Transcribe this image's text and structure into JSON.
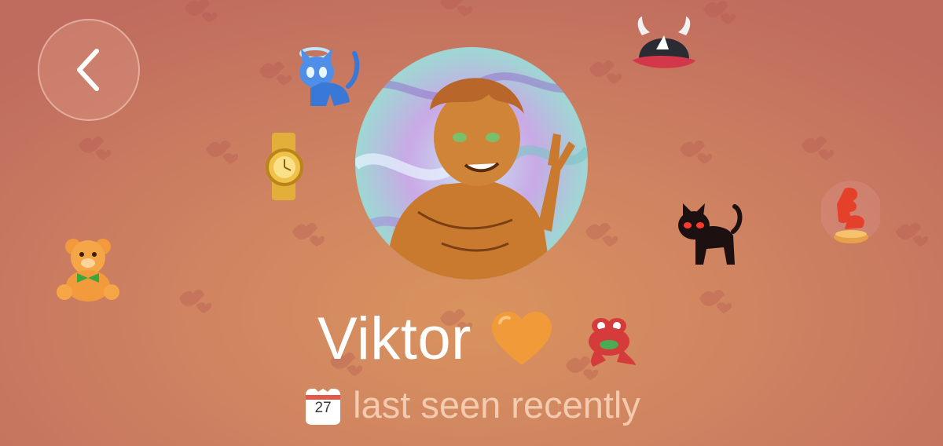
{
  "profile": {
    "name": "Viktor",
    "status": "last seen recently",
    "calendar_day": "27"
  },
  "icons": {
    "back": "chevron-left-icon",
    "name_emoji": "orange-heart-icon",
    "status_badge": "calendar-icon"
  },
  "gifts": [
    "blue-angel-cat-gift",
    "gold-watch-gift",
    "teddy-bear-gift",
    "devil-cap-gift",
    "black-cat-gift",
    "red-crab-gift",
    "pepe-frog-gift"
  ],
  "colors": {
    "accent": "#f09a3a",
    "background": "#cf8361",
    "status_text": "#ffe2c8"
  }
}
